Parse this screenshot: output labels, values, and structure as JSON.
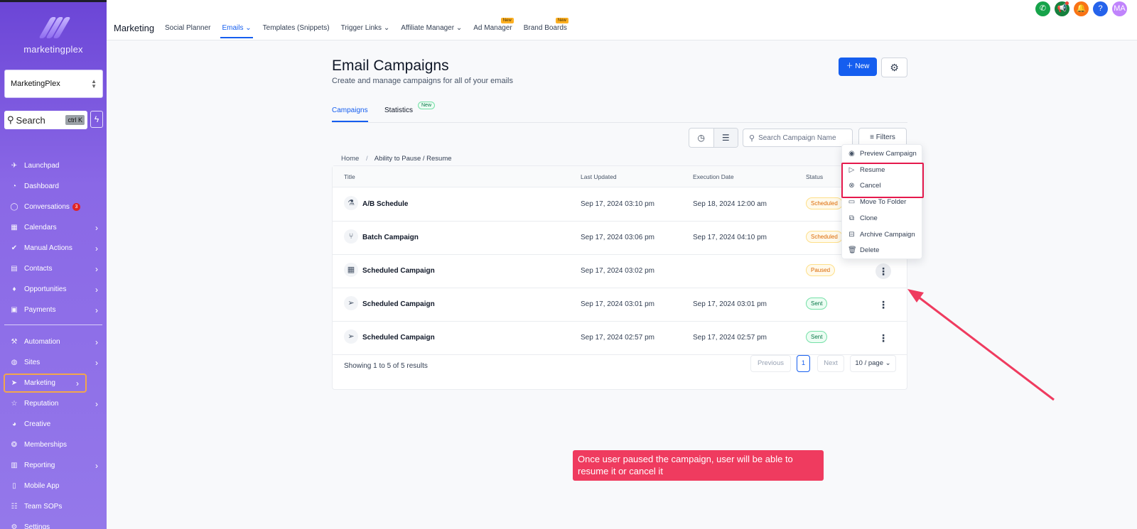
{
  "sidebar": {
    "logo_text": "marketingplex",
    "account": "MarketingPlex",
    "search_label": "Search",
    "search_kbd": "ctrl K",
    "items": [
      {
        "label": "Launchpad",
        "icon": "rocket-icon",
        "chevron": false
      },
      {
        "label": "Dashboard",
        "icon": "gauge-icon",
        "chevron": false
      },
      {
        "label": "Conversations",
        "icon": "chat-icon",
        "chevron": false,
        "badge": "3"
      },
      {
        "label": "Calendars",
        "icon": "calendar-icon",
        "chevron": true
      },
      {
        "label": "Manual Actions",
        "icon": "check-icon",
        "chevron": true
      },
      {
        "label": "Contacts",
        "icon": "contacts-icon",
        "chevron": true
      },
      {
        "label": "Opportunities",
        "icon": "opportunities-icon",
        "chevron": true
      },
      {
        "label": "Payments",
        "icon": "payments-icon",
        "chevron": true
      },
      {
        "label": "Automation",
        "icon": "automation-icon",
        "chevron": true
      },
      {
        "label": "Sites",
        "icon": "globe-icon",
        "chevron": true
      },
      {
        "label": "Marketing",
        "icon": "send-icon",
        "chevron": true,
        "active": true
      },
      {
        "label": "Reputation",
        "icon": "star-icon",
        "chevron": true
      },
      {
        "label": "Creative",
        "icon": "palette-icon",
        "chevron": false
      },
      {
        "label": "Memberships",
        "icon": "badge-icon",
        "chevron": false
      },
      {
        "label": "Reporting",
        "icon": "chart-icon",
        "chevron": true
      },
      {
        "label": "Mobile App",
        "icon": "phone-icon",
        "chevron": false
      },
      {
        "label": "Team SOPs",
        "icon": "list-icon",
        "chevron": false
      },
      {
        "label": "Settings",
        "icon": "gear-icon",
        "chevron": false
      }
    ]
  },
  "topbar": {
    "section": "Marketing",
    "tabs": [
      {
        "label": "Social Planner"
      },
      {
        "label": "Emails",
        "active": true,
        "caret": true
      },
      {
        "label": "Templates (Snippets)"
      },
      {
        "label": "Trigger Links",
        "caret": true
      },
      {
        "label": "Affiliate Manager",
        "caret": true
      },
      {
        "label": "Ad Manager",
        "new": "New"
      },
      {
        "label": "Brand Boards",
        "new": "New"
      }
    ],
    "user_initials": "MA",
    "icon_colors": {
      "phone": "#16a34a",
      "megaphone": "#15803d",
      "bell": "#f97316",
      "help": "#2563eb",
      "avatar": "#c084fc"
    }
  },
  "page": {
    "title": "Email Campaigns",
    "subtitle": "Create and manage campaigns for all of your emails",
    "new_button": "New",
    "tabs": [
      {
        "label": "Campaigns",
        "active": true
      },
      {
        "label": "Statistics",
        "pill": "New"
      }
    ],
    "search_placeholder": "Search Campaign Name",
    "filters_label": "Filters",
    "breadcrumb": {
      "home": "Home",
      "separator": "/",
      "current": "Ability to Pause / Resume"
    }
  },
  "table": {
    "columns": [
      "Title",
      "Last Updated",
      "Execution Date",
      "Status"
    ],
    "rows": [
      {
        "icon": "flask-icon",
        "title": "A/B Schedule",
        "updated": "Sep 17, 2024 03:10 pm",
        "execution": "Sep 18, 2024 12:00 am",
        "status": "Scheduled",
        "status_kind": "sched"
      },
      {
        "icon": "batch-icon",
        "title": "Batch Campaign",
        "updated": "Sep 17, 2024 03:06 pm",
        "execution": "Sep 17, 2024 04:10 pm",
        "status": "Scheduled",
        "status_kind": "sched"
      },
      {
        "icon": "calendar-icon",
        "title": "Scheduled Campaign",
        "updated": "Sep 17, 2024 03:02 pm",
        "execution": "",
        "status": "Paused",
        "status_kind": "paused"
      },
      {
        "icon": "send-icon",
        "title": "Scheduled Campaign",
        "updated": "Sep 17, 2024 03:01 pm",
        "execution": "Sep 17, 2024 03:01 pm",
        "status": "Sent",
        "status_kind": "sent"
      },
      {
        "icon": "send-icon",
        "title": "Scheduled Campaign",
        "updated": "Sep 17, 2024 02:57 pm",
        "execution": "Sep 17, 2024 02:57 pm",
        "status": "Sent",
        "status_kind": "sent"
      }
    ],
    "showing": "Showing 1 to 5 of 5 results",
    "pagination": {
      "previous": "Previous",
      "page": "1",
      "next": "Next",
      "per_page": "10 / page"
    }
  },
  "menu": {
    "items": [
      {
        "label": "Preview Campaign",
        "icon": "eye-icon",
        "glyph": "◉"
      },
      {
        "label": "Resume",
        "icon": "play-circle-icon",
        "glyph": "▷"
      },
      {
        "label": "Cancel",
        "icon": "x-circle-icon",
        "glyph": "⊗"
      },
      {
        "label": "Move To Folder",
        "icon": "folder-icon",
        "glyph": "▭"
      },
      {
        "label": "Clone",
        "icon": "copy-icon",
        "glyph": "⧉"
      },
      {
        "label": "Archive Campaign",
        "icon": "archive-icon",
        "glyph": "⊟"
      },
      {
        "label": "Delete",
        "icon": "trash-icon",
        "glyph": "🗑"
      }
    ]
  },
  "annotation": {
    "text": "Once user paused the campaign, user will be able to resume it or cancel it",
    "color": "#ef3b5f"
  }
}
